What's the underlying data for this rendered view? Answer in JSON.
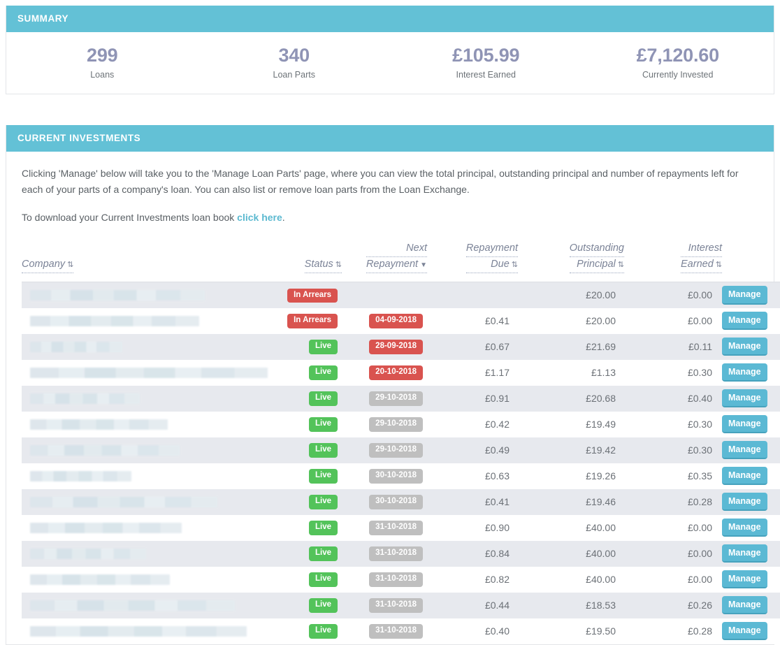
{
  "summary": {
    "header": "SUMMARY",
    "stats": [
      {
        "value": "299",
        "label": "Loans"
      },
      {
        "value": "340",
        "label": "Loan Parts"
      },
      {
        "value": "£105.99",
        "label": "Interest Earned"
      },
      {
        "value": "£7,120.60",
        "label": "Currently Invested"
      }
    ]
  },
  "investments": {
    "header": "CURRENT INVESTMENTS",
    "description_1": "Clicking 'Manage' below will take you to the 'Manage Loan Parts' page, where you can view the total principal, outstanding principal and number of repayments left for each of your parts of a company's loan. You can also list or remove loan parts from the Loan Exchange.",
    "description_2_before": "To download your Current Investments loan book ",
    "description_2_link": "click here",
    "description_2_after": ".",
    "columns": {
      "company": {
        "label": "Company",
        "sort": "⇅",
        "sort_state": "none"
      },
      "status": {
        "label": "Status",
        "sort": "⇅",
        "sort_state": "none"
      },
      "next_repayment_line1": "Next",
      "next_repayment_line2": "Repayment",
      "next_repayment_sort": "▼",
      "next_repayment_sort_state": "desc",
      "repayment_due_line1": "Repayment",
      "repayment_due_line2": "Due",
      "repayment_due_sort": "⇅",
      "outstanding_principal_line1": "Outstanding",
      "outstanding_principal_line2": "Principal",
      "outstanding_principal_sort": "⇅",
      "interest_earned_line1": "Interest",
      "interest_earned_line2": "Earned",
      "interest_earned_sort": "⇅"
    },
    "manage_label": "Manage",
    "rows": [
      {
        "company_redacted_width": 250,
        "status": "In Arrears",
        "status_type": "arrears",
        "next_repayment": "",
        "next_type": "none",
        "repayment_due": "",
        "outstanding_principal": "£20.00",
        "interest_earned": "£0.00"
      },
      {
        "company_redacted_width": 242,
        "status": "In Arrears",
        "status_type": "arrears",
        "next_repayment": "04-09-2018",
        "next_type": "late",
        "repayment_due": "£0.41",
        "outstanding_principal": "£20.00",
        "interest_earned": "£0.00"
      },
      {
        "company_redacted_width": 132,
        "status": "Live",
        "status_type": "live",
        "next_repayment": "28-09-2018",
        "next_type": "late",
        "repayment_due": "£0.67",
        "outstanding_principal": "£21.69",
        "interest_earned": "£0.11"
      },
      {
        "company_redacted_width": 340,
        "status": "Live",
        "status_type": "live",
        "next_repayment": "20-10-2018",
        "next_type": "late",
        "repayment_due": "£1.17",
        "outstanding_principal": "£1.13",
        "interest_earned": "£0.30"
      },
      {
        "company_redacted_width": 157,
        "status": "Live",
        "status_type": "live",
        "next_repayment": "29-10-2018",
        "next_type": "ok",
        "repayment_due": "£0.91",
        "outstanding_principal": "£20.68",
        "interest_earned": "£0.40"
      },
      {
        "company_redacted_width": 197,
        "status": "Live",
        "status_type": "live",
        "next_repayment": "29-10-2018",
        "next_type": "ok",
        "repayment_due": "£0.42",
        "outstanding_principal": "£19.49",
        "interest_earned": "£0.30"
      },
      {
        "company_redacted_width": 214,
        "status": "Live",
        "status_type": "live",
        "next_repayment": "29-10-2018",
        "next_type": "ok",
        "repayment_due": "£0.49",
        "outstanding_principal": "£19.42",
        "interest_earned": "£0.30"
      },
      {
        "company_redacted_width": 145,
        "status": "Live",
        "status_type": "live",
        "next_repayment": "30-10-2018",
        "next_type": "ok",
        "repayment_due": "£0.63",
        "outstanding_principal": "£19.26",
        "interest_earned": "£0.35"
      },
      {
        "company_redacted_width": 268,
        "status": "Live",
        "status_type": "live",
        "next_repayment": "30-10-2018",
        "next_type": "ok",
        "repayment_due": "£0.41",
        "outstanding_principal": "£19.46",
        "interest_earned": "£0.28"
      },
      {
        "company_redacted_width": 217,
        "status": "Live",
        "status_type": "live",
        "next_repayment": "31-10-2018",
        "next_type": "ok",
        "repayment_due": "£0.90",
        "outstanding_principal": "£40.00",
        "interest_earned": "£0.00"
      },
      {
        "company_redacted_width": 166,
        "status": "Live",
        "status_type": "live",
        "next_repayment": "31-10-2018",
        "next_type": "ok",
        "repayment_due": "£0.84",
        "outstanding_principal": "£40.00",
        "interest_earned": "£0.00"
      },
      {
        "company_redacted_width": 200,
        "status": "Live",
        "status_type": "live",
        "next_repayment": "31-10-2018",
        "next_type": "ok",
        "repayment_due": "£0.82",
        "outstanding_principal": "£40.00",
        "interest_earned": "£0.00"
      },
      {
        "company_redacted_width": 293,
        "status": "Live",
        "status_type": "live",
        "next_repayment": "31-10-2018",
        "next_type": "ok",
        "repayment_due": "£0.44",
        "outstanding_principal": "£18.53",
        "interest_earned": "£0.26"
      },
      {
        "company_redacted_width": 310,
        "status": "Live",
        "status_type": "live",
        "next_repayment": "31-10-2018",
        "next_type": "ok",
        "repayment_due": "£0.40",
        "outstanding_principal": "£19.50",
        "interest_earned": "£0.28"
      }
    ]
  },
  "colors": {
    "header_teal": "#63c1d6",
    "link_teal": "#5bb9d0",
    "stat_value": "#8f94b5",
    "badge_red": "#d9534f",
    "badge_green": "#53c35a",
    "badge_grey": "#bfbfbf",
    "button_teal": "#5bb9d4",
    "row_stripe": "#e7e9ee"
  }
}
